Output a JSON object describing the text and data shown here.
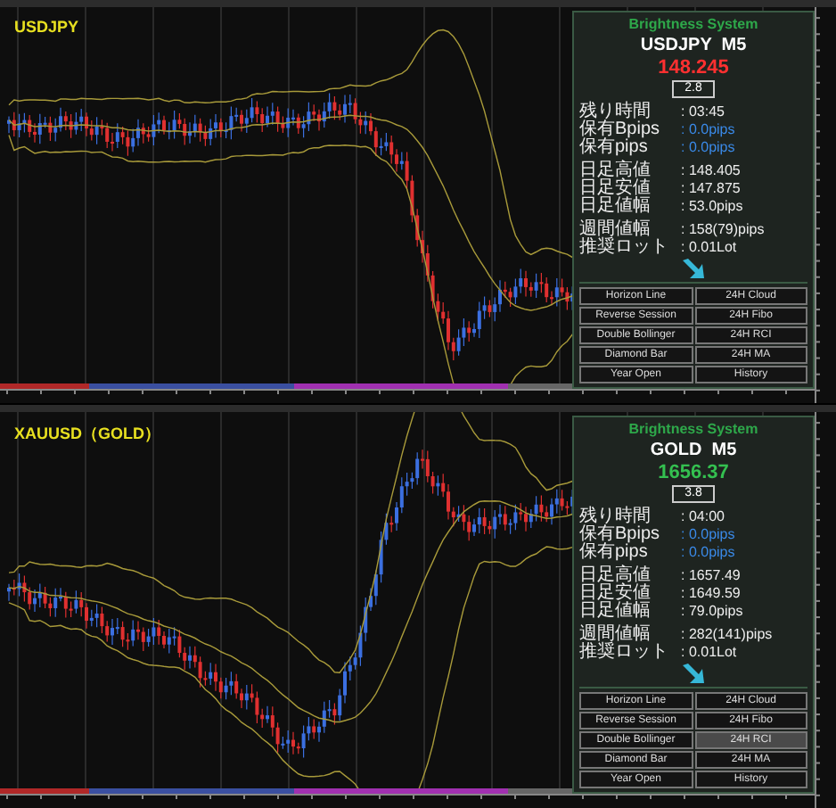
{
  "panes": [
    {
      "symbol_label": "USDJPY",
      "panel": {
        "title": "Brightness System",
        "symbol": "USDJPY  M5",
        "price": "148.245",
        "price_up": false,
        "spread": "2.8",
        "rows": [
          [
            {
              "label": "残り時間",
              "value": ": 03:45",
              "highlight": false
            },
            {
              "label": "保有Bpips",
              "value": ": 0.0pips",
              "highlight": true
            },
            {
              "label": "保有pips",
              "value": ": 0.0pips",
              "highlight": true
            }
          ],
          [
            {
              "label": "日足高値",
              "value": ": 148.405",
              "highlight": false
            },
            {
              "label": "日足安値",
              "value": ": 147.875",
              "highlight": false
            },
            {
              "label": "日足値幅",
              "value": ": 53.0pips",
              "highlight": false
            }
          ],
          [
            {
              "label": "週間値幅",
              "value": ": 158(79)pips",
              "highlight": false
            },
            {
              "label": "推奨ロット",
              "value": ": 0.01Lot",
              "highlight": false
            }
          ]
        ],
        "buttons": [
          {
            "label": "Horizon Line",
            "selected": false
          },
          {
            "label": "24H Cloud",
            "selected": false
          },
          {
            "label": "Reverse Session",
            "selected": false
          },
          {
            "label": "24H Fibo",
            "selected": false
          },
          {
            "label": "Double Bollinger",
            "selected": false
          },
          {
            "label": "24H RCI",
            "selected": false
          },
          {
            "label": "Diamond Bar",
            "selected": false
          },
          {
            "label": "24H MA",
            "selected": false
          },
          {
            "label": "Year Open",
            "selected": false
          },
          {
            "label": "History",
            "selected": false
          }
        ]
      }
    },
    {
      "symbol_label": "XAUUSD（GOLD）",
      "panel": {
        "title": "Brightness System",
        "symbol": "GOLD  M5",
        "price": "1656.37",
        "price_up": true,
        "spread": "3.8",
        "rows": [
          [
            {
              "label": "残り時間",
              "value": ": 04:00",
              "highlight": false
            },
            {
              "label": "保有Bpips",
              "value": ": 0.0pips",
              "highlight": true
            },
            {
              "label": "保有pips",
              "value": ": 0.0pips",
              "highlight": true
            }
          ],
          [
            {
              "label": "日足高値",
              "value": ": 1657.49",
              "highlight": false
            },
            {
              "label": "日足安値",
              "value": ": 1649.59",
              "highlight": false
            },
            {
              "label": "日足値幅",
              "value": ": 79.0pips",
              "highlight": false
            }
          ],
          [
            {
              "label": "週間値幅",
              "value": ": 282(141)pips",
              "highlight": false
            },
            {
              "label": "推奨ロット",
              "value": ": 0.01Lot",
              "highlight": false
            }
          ]
        ],
        "buttons": [
          {
            "label": "Horizon Line",
            "selected": false
          },
          {
            "label": "24H Cloud",
            "selected": false
          },
          {
            "label": "Reverse Session",
            "selected": false
          },
          {
            "label": "24H Fibo",
            "selected": false
          },
          {
            "label": "Double Bollinger",
            "selected": false
          },
          {
            "label": "24H RCI",
            "selected": true
          },
          {
            "label": "Diamond Bar",
            "selected": false
          },
          {
            "label": "24H MA",
            "selected": false
          },
          {
            "label": "Year Open",
            "selected": false
          },
          {
            "label": "History",
            "selected": false
          }
        ]
      }
    }
  ]
}
